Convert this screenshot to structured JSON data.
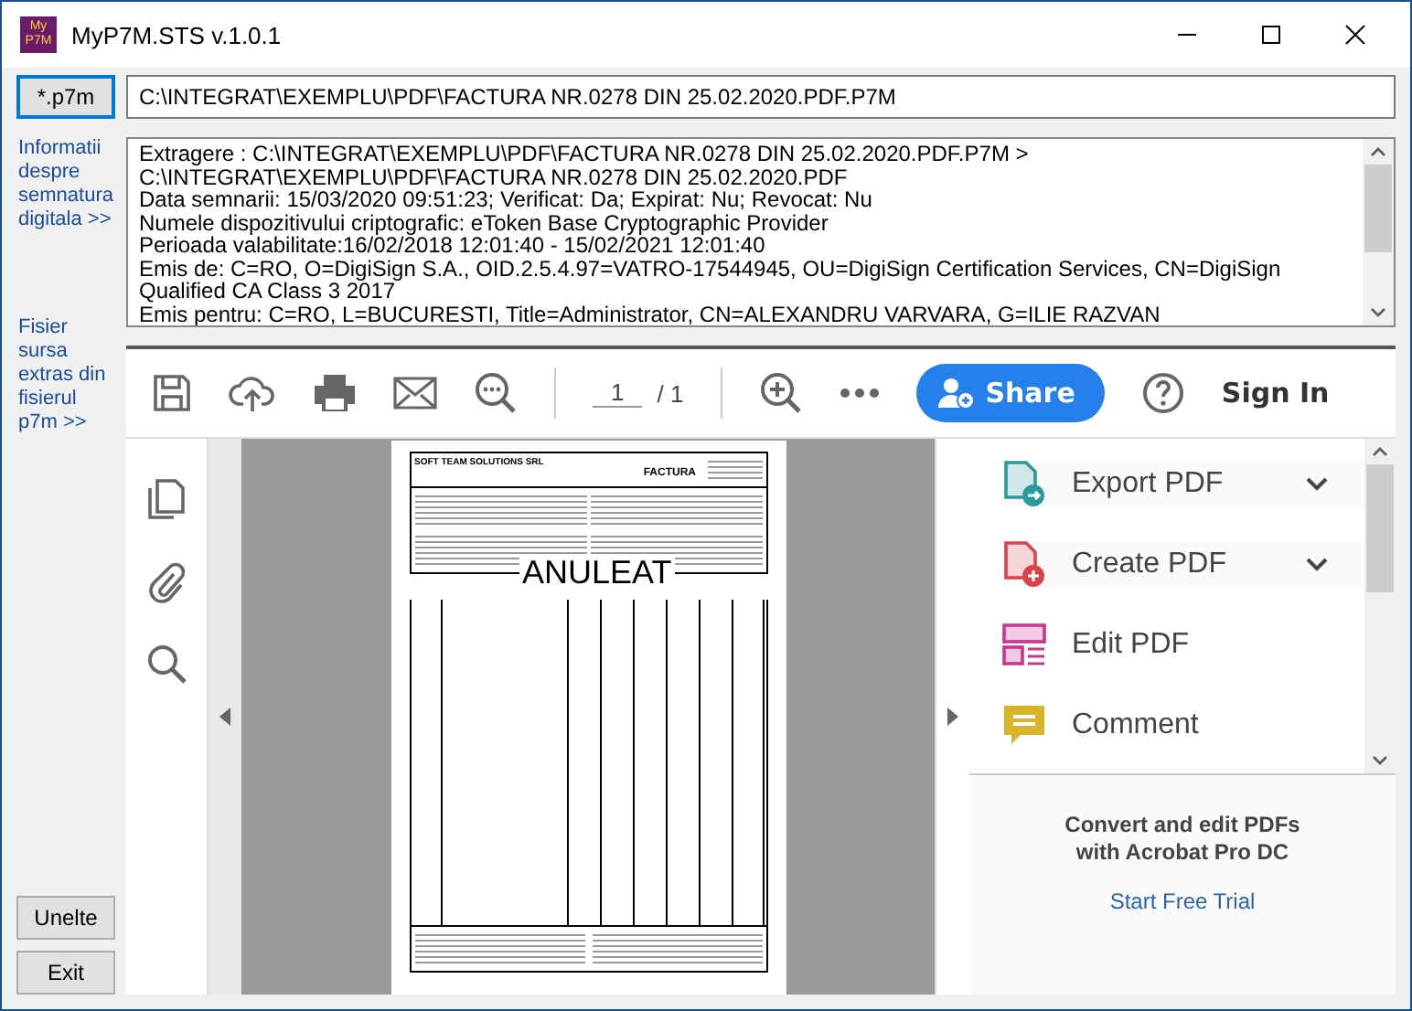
{
  "window": {
    "title": "MyP7M.STS v.1.0.1",
    "logo": "My P7M"
  },
  "file_button": "*.p7m",
  "path_field": {
    "value": "C:\\INTEGRAT\\EXEMPLU\\PDF\\FACTURA NR.0278 DIN 25.02.2020.PDF.P7M"
  },
  "links": [
    "Informatii despre semnatura digitala >>",
    "Fisier sursa extras din fisierul p7m >>"
  ],
  "info_lines": [
    "Extragere : C:\\INTEGRAT\\EXEMPLU\\PDF\\FACTURA NR.0278 DIN 25.02.2020.PDF.P7M > C:\\INTEGRAT\\EXEMPLU\\PDF\\FACTURA NR.0278 DIN 25.02.2020.PDF",
    "Data semnarii: 15/03/2020 09:51:23; Verificat: Da; Expirat: Nu; Revocat: Nu",
    "Numele dispozitivului criptografic: eToken Base Cryptographic Provider",
    "Perioada valabilitate:16/02/2018 12:01:40 - 15/02/2021 12:01:40",
    "Emis de: C=RO, O=DigiSign S.A., OID.2.5.4.97=VATRO-17544945, OU=DigiSign Certification Services, CN=DigiSign Qualified CA Class 3 2017",
    "Emis pentru: C=RO, L=BUCURESTI, Title=Administrator, CN=ALEXANDRU VARVARA, G=ILIE RAZVAN"
  ],
  "viewer": {
    "page_current": "1",
    "page_total": "/ 1",
    "share": "Share",
    "sign_in": "Sign In",
    "document": {
      "company": "SOFT TEAM SOLUTIONS SRL",
      "title": "FACTURA",
      "stamp": "ANULEAT"
    },
    "tools": [
      {
        "label": "Export PDF",
        "kind": "export",
        "dropdown": true
      },
      {
        "label": "Create PDF",
        "kind": "create",
        "dropdown": true
      },
      {
        "label": "Edit PDF",
        "kind": "edit",
        "dropdown": false
      },
      {
        "label": "Comment",
        "kind": "comment",
        "dropdown": false
      }
    ],
    "promo": {
      "text": "Convert and edit PDFs with Acrobat Pro DC",
      "link": "Start Free Trial"
    }
  },
  "buttons": [
    "Unelte",
    "Exit"
  ]
}
